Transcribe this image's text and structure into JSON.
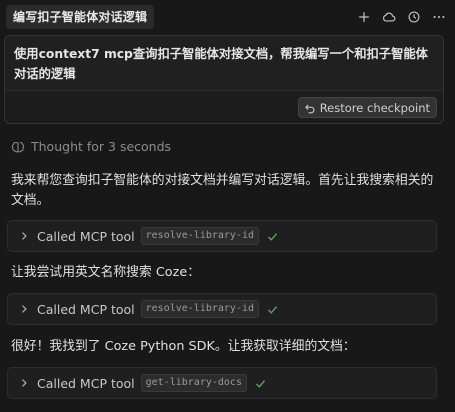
{
  "header": {
    "title": "编写扣子智能体对话逻辑",
    "icons": [
      "plus-icon",
      "cloud-icon",
      "history-icon",
      "more-icon"
    ]
  },
  "prompt": {
    "text": "使用context7 mcp查询扣子智能体对接文档，帮我编写一个和扣子智能体对话的逻辑",
    "restore_label": "Restore checkpoint"
  },
  "thought": {
    "label": "Thought for 3 seconds"
  },
  "messages": [
    {
      "text": "我来帮您查询扣子智能体的对接文档并编写对话逻辑。首先让我搜索相关的文档。"
    },
    {
      "text": "让我尝试用英文名称搜索 Coze："
    },
    {
      "text": "很好！我找到了 Coze Python SDK。让我获取详细的文档："
    }
  ],
  "tool_calls": [
    {
      "label": "Called MCP tool",
      "tool": "resolve-library-id"
    },
    {
      "label": "Called MCP tool",
      "tool": "resolve-library-id"
    },
    {
      "label": "Called MCP tool",
      "tool": "get-library-docs"
    }
  ],
  "colors": {
    "background": "#181818",
    "success_check": "#5faa62"
  }
}
